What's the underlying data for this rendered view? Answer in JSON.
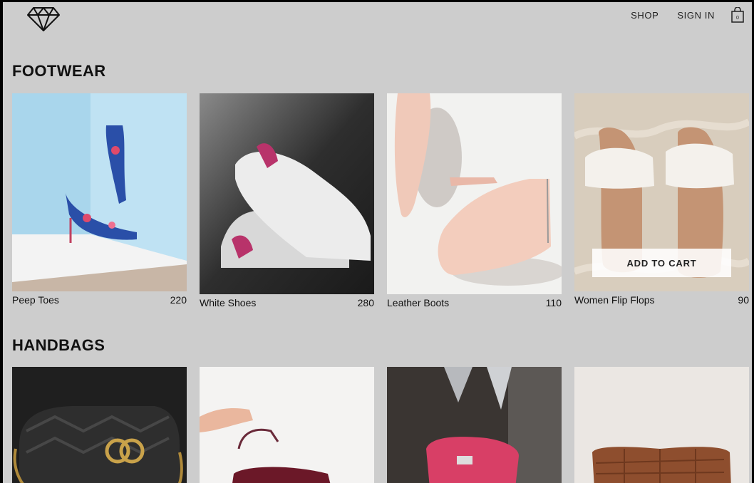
{
  "header": {
    "logo_icon": "diamond-icon",
    "nav": [
      {
        "label": "SHOP"
      },
      {
        "label": "SIGN IN"
      }
    ],
    "cart_icon": "shopping-bag-icon",
    "cart_count": "0"
  },
  "sections": [
    {
      "title": "FOOTWEAR",
      "items": [
        {
          "name": "Peep Toes",
          "price": "220"
        },
        {
          "name": "White Shoes",
          "price": "280"
        },
        {
          "name": "Leather Boots",
          "price": "110"
        },
        {
          "name": "Women Flip Flops",
          "price": "90",
          "button": "ADD TO CART"
        }
      ]
    },
    {
      "title": "HANDBAGS",
      "items": [
        {
          "name": "",
          "price": ""
        },
        {
          "name": "",
          "price": ""
        },
        {
          "name": "",
          "price": ""
        },
        {
          "name": "",
          "price": ""
        }
      ]
    }
  ]
}
